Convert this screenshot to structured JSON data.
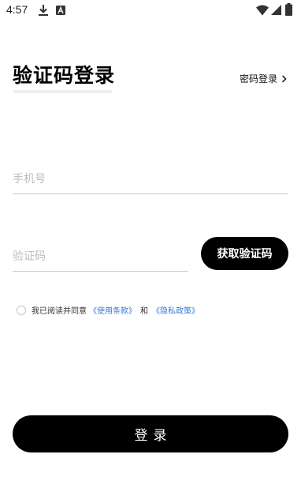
{
  "status_bar": {
    "time": "4:57",
    "icons": [
      "download-icon",
      "a-icon",
      "wifi-icon",
      "signal-icon",
      "battery-icon"
    ]
  },
  "header": {
    "title": "验证码登录",
    "password_login_label": "密码登录",
    "password_login_icon": "chevron-right-icon"
  },
  "form": {
    "phone_placeholder": "手机号",
    "phone_value": "",
    "code_placeholder": "验证码",
    "code_value": "",
    "get_code_label": "获取验证码"
  },
  "agreement": {
    "checked": false,
    "text": "我已阅读并同意",
    "terms_label": "《使用条款》",
    "and_text": "和",
    "privacy_label": "《隐私政策》",
    "link_color": "#3a78d6"
  },
  "login_button_label": "登录",
  "colors": {
    "primary_button": "#000000",
    "button_text": "#ffffff",
    "divider": "#c9c9c9"
  }
}
